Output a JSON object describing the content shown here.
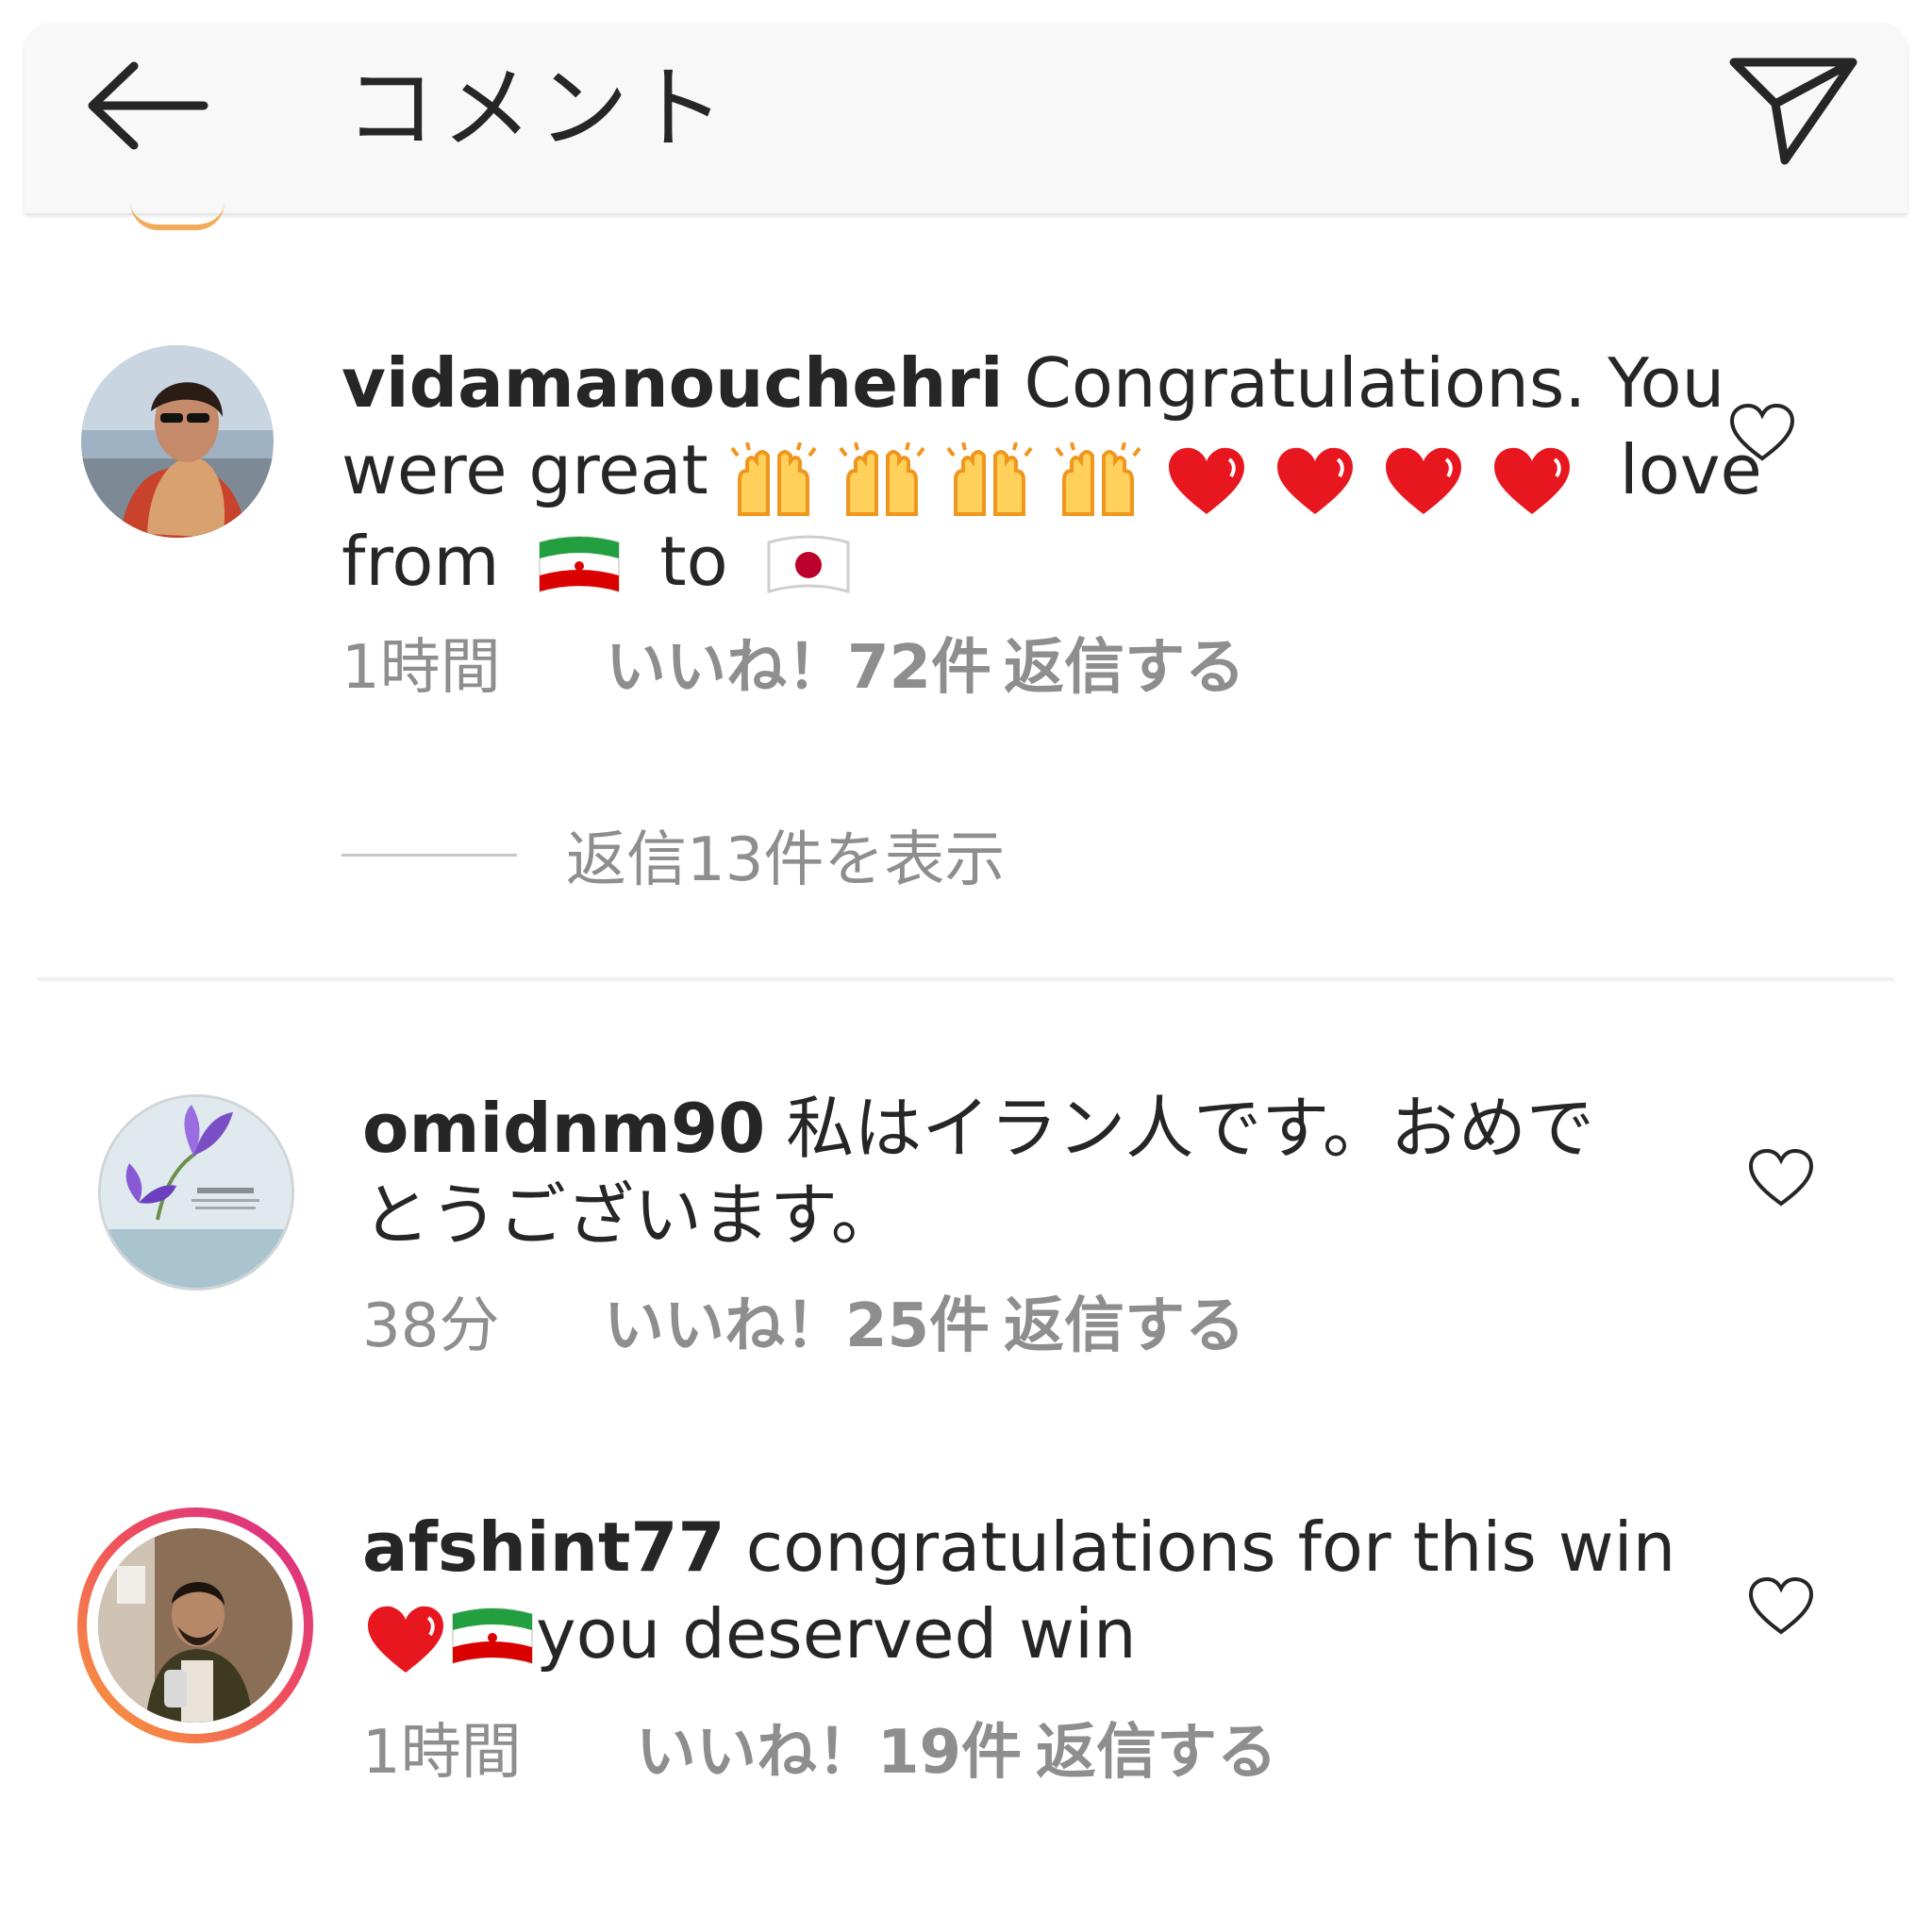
{
  "header": {
    "title": "コメント",
    "back_icon": "arrow-left-icon",
    "share_icon": "paper-plane-icon"
  },
  "comments": [
    {
      "username": "vidamanouchehri",
      "text_line1": "Congratulations. You",
      "text_line2_start": "were great",
      "text_line2_end": "love",
      "text_line3_start": "from",
      "text_line3_mid": "to",
      "emojis": [
        "raised-hands-icon",
        "raised-hands-icon",
        "raised-hands-icon",
        "raised-hands-icon",
        "red-heart-icon",
        "red-heart-icon",
        "red-heart-icon",
        "red-heart-icon",
        "iran-flag-icon",
        "japan-flag-icon"
      ],
      "time": "1時間",
      "likes": "いいね！72件",
      "reply": "返信する",
      "view_replies": "返信13件を表示"
    },
    {
      "username": "omidnm90",
      "text_line1": "私はイラン人です。おめで",
      "text_line2": "とうございます。",
      "time": "38分",
      "likes": "いいね！25件",
      "reply": "返信する"
    },
    {
      "username": "afshint77",
      "text_line1": "congratulations for this win",
      "text_line2": "you deserved win",
      "emojis": [
        "red-heart-icon",
        "iran-flag-icon"
      ],
      "time": "1時間",
      "likes": "いいね！19件",
      "reply": "返信する"
    }
  ],
  "colors": {
    "header_bg": "#f8f8f8",
    "text": "#262626",
    "muted": "#8e8e8e",
    "heart_red": "#e8171f",
    "story_ring_start": "#f9a13a",
    "story_ring_end": "#d62a8b"
  }
}
